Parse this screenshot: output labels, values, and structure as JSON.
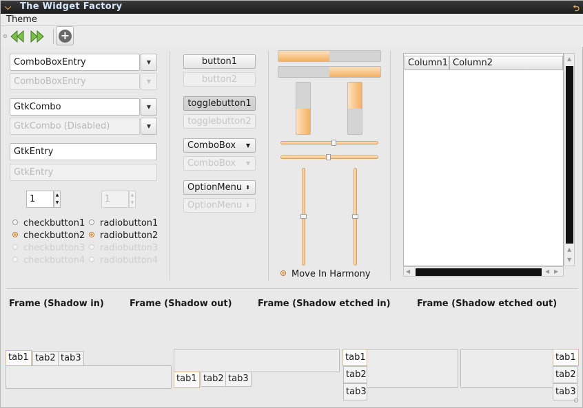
{
  "window": {
    "title": "The Widget Factory"
  },
  "menubar": {
    "items": [
      "Theme"
    ]
  },
  "toolbar": {
    "back_icon": "go-back-icon",
    "forward_icon": "go-forward-icon",
    "add_icon": "add-icon"
  },
  "entries": {
    "combo_entry": "ComboBoxEntry",
    "combo_entry_disabled": "ComboBoxEntry",
    "gtk_combo": "GtkCombo",
    "gtk_combo_disabled": "GtkCombo (Disabled)",
    "gtk_entry": "GtkEntry",
    "gtk_entry_disabled": "GtkEntry"
  },
  "spinners": {
    "enabled": "1",
    "disabled": "1"
  },
  "checks": [
    "checkbutton1",
    "checkbutton2",
    "checkbutton3",
    "checkbutton4"
  ],
  "radios": [
    "radiobutton1",
    "radiobutton2",
    "radiobutton3",
    "radiobutton4"
  ],
  "buttons": {
    "button1": "button1",
    "button2": "button2",
    "toggle1": "togglebutton1",
    "toggle2": "togglebutton2",
    "combobox": "ComboBox",
    "combobox_disabled": "ComboBox",
    "optionmenu": "OptionMenu",
    "optionmenu_disabled": "OptionMenu"
  },
  "progress": {
    "h1": 0.5,
    "h2": 0.5,
    "v1": 0.5,
    "v2": 0.5
  },
  "scales": {
    "h1": 0.5,
    "h2": 0.5,
    "v1": 0.5,
    "v2": 0.5
  },
  "move_in_harmony": "Move In Harmony",
  "tree": {
    "columns": [
      "Column1",
      "Column2"
    ]
  },
  "frames": [
    "Frame (Shadow in)",
    "Frame (Shadow out)",
    "Frame (Shadow etched in)",
    "Frame (Shadow etched out)"
  ],
  "tabs": [
    "tab1",
    "tab2",
    "tab3"
  ],
  "colors": {
    "accent": "#f4b05f",
    "title_text": "#d6e6fa"
  }
}
